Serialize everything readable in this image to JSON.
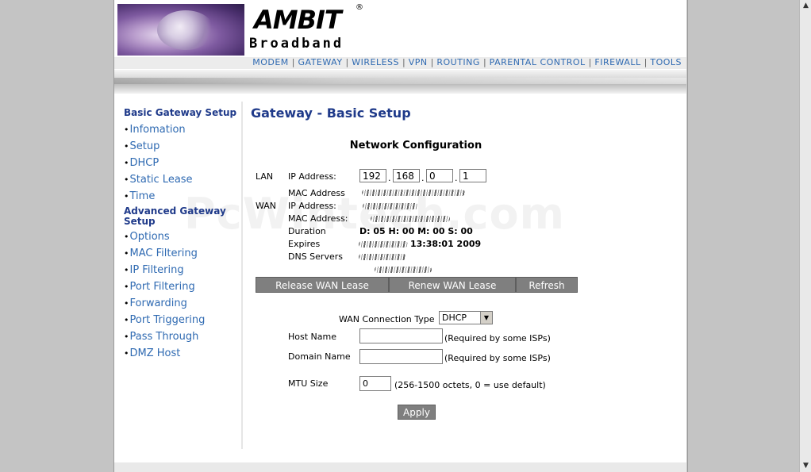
{
  "brand": {
    "name": "AMBIT",
    "reg": "®",
    "sub": "Broadband"
  },
  "topnav": [
    "MODEM",
    "GATEWAY",
    "WIRELESS",
    "VPN",
    "ROUTING",
    "PARENTAL CONTROL",
    "FIREWALL",
    "TOOLS"
  ],
  "sidebar": {
    "heading1": "Basic Gateway Setup",
    "group1": [
      "Infomation",
      "Setup",
      "DHCP",
      "Static Lease",
      "Time"
    ],
    "heading2": "Advanced Gateway Setup",
    "group2": [
      "Options",
      "MAC Filtering",
      "IP Filtering",
      "Port Filtering",
      "Forwarding",
      "Port Triggering",
      "Pass Through",
      "DMZ Host"
    ]
  },
  "main": {
    "title": "Gateway - Basic Setup",
    "section": "Network Configuration",
    "lan_label": "LAN",
    "wan_label": "WAN",
    "ip_label": "IP Address:",
    "lan_ip": [
      "192",
      "168",
      "0",
      "1"
    ],
    "mac_label": "MAC Address",
    "wan_ip_label": "IP Address:",
    "wan_mac_label": "MAC Address:",
    "duration_label": "Duration",
    "duration_value": "D: 05 H: 00 M: 00 S: 00",
    "expires_label": "Expires",
    "expires_value": "13:38:01 2009",
    "dns_label": "DNS Servers"
  },
  "buttons": {
    "release": "Release WAN Lease",
    "renew": "Renew WAN Lease",
    "refresh": "Refresh",
    "apply": "Apply"
  },
  "form": {
    "conn_type_label": "WAN Connection Type",
    "conn_type_value": "DHCP",
    "host_label": "Host Name",
    "host_value": "",
    "host_hint": "(Required by some ISPs)",
    "domain_label": "Domain Name",
    "domain_value": "",
    "domain_hint": "(Required by some ISPs)",
    "mtu_label": "MTU Size",
    "mtu_value": "0",
    "mtu_hint": "(256-1500 octets, 0 = use default)"
  },
  "watermark": "PcWintech.com",
  "colors": {
    "nav": "#2f6ab2",
    "heading": "#1f3a8a",
    "button": "#7f7f7f"
  }
}
